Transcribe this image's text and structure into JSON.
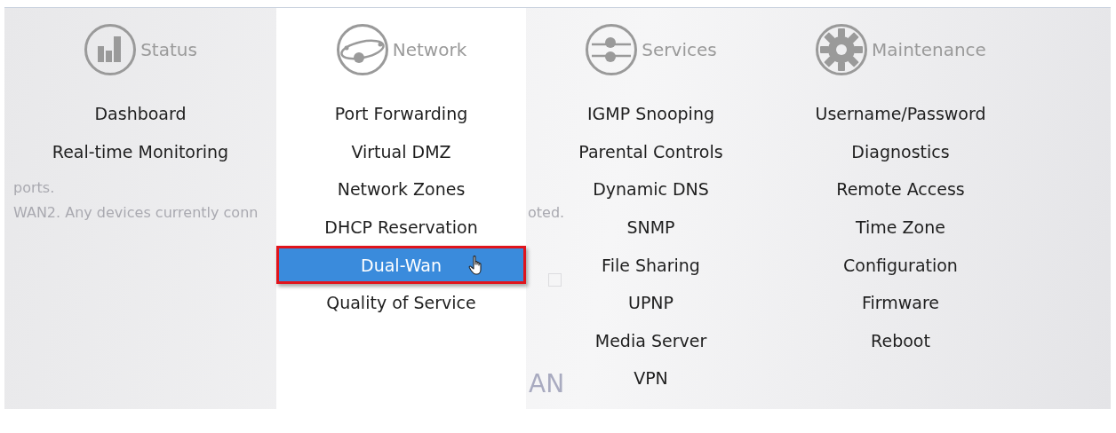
{
  "background": {
    "lines": [
      {
        "left": "ports."
      },
      {
        "left": "WAN2. Any devices currently conn",
        "right": "oted."
      }
    ],
    "checkbox": {
      "checked": false
    },
    "heading": "AN"
  },
  "menus": [
    {
      "kind": "status",
      "title": "Status",
      "items": [
        {
          "label": "Dashboard",
          "selected": false
        },
        {
          "label": "Real-time Monitoring",
          "selected": false
        }
      ]
    },
    {
      "kind": "network",
      "title": "Network",
      "items": [
        {
          "label": "Port Forwarding",
          "selected": false
        },
        {
          "label": "Virtual DMZ",
          "selected": false
        },
        {
          "label": "Network Zones",
          "selected": false
        },
        {
          "label": "DHCP Reservation",
          "selected": false
        },
        {
          "label": "Dual-Wan",
          "selected": true
        },
        {
          "label": "Quality of Service",
          "selected": false
        }
      ]
    },
    {
      "kind": "services",
      "title": "Services",
      "items": [
        {
          "label": "IGMP Snooping",
          "selected": false
        },
        {
          "label": "Parental Controls",
          "selected": false
        },
        {
          "label": "Dynamic DNS",
          "selected": false
        },
        {
          "label": "SNMP",
          "selected": false
        },
        {
          "label": "File Sharing",
          "selected": false
        },
        {
          "label": "UPNP",
          "selected": false
        },
        {
          "label": "Media Server",
          "selected": false
        },
        {
          "label": "VPN",
          "selected": false
        }
      ]
    },
    {
      "kind": "maintenance",
      "title": "Maintenance",
      "items": [
        {
          "label": "Username/Password",
          "selected": false
        },
        {
          "label": "Diagnostics",
          "selected": false
        },
        {
          "label": "Remote Access",
          "selected": false
        },
        {
          "label": "Time Zone",
          "selected": false
        },
        {
          "label": "Configuration",
          "selected": false
        },
        {
          "label": "Firmware",
          "selected": false
        },
        {
          "label": "Reboot",
          "selected": false
        }
      ]
    }
  ]
}
